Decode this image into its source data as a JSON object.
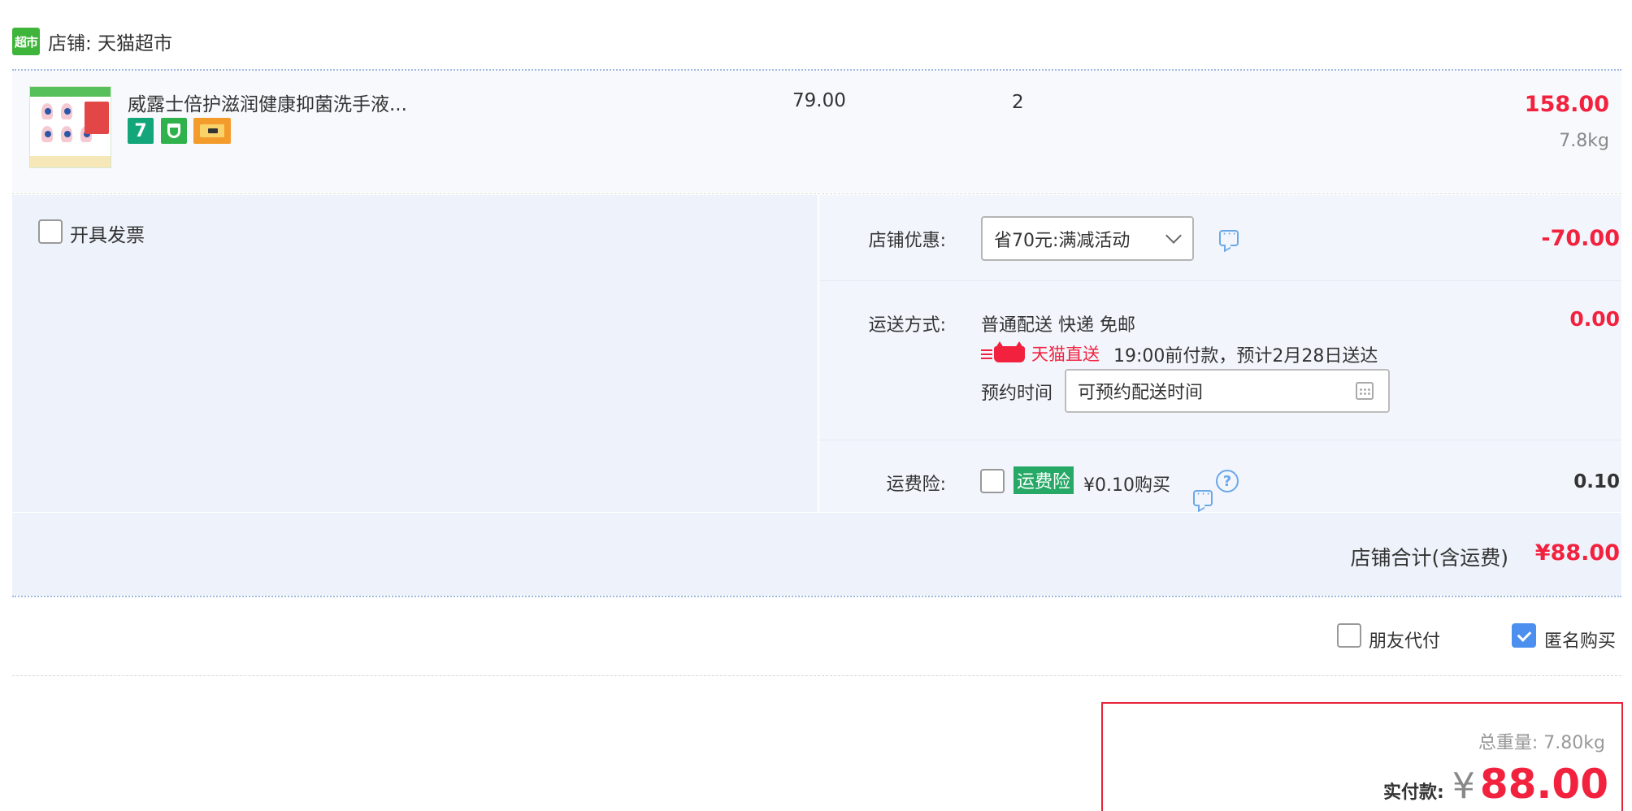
{
  "shop": {
    "logo_text": "超市",
    "label": "店铺: 天猫超市"
  },
  "item": {
    "title": "威露士倍护滋润健康抑菌洗手液...",
    "unit_price": "79.00",
    "quantity": "2",
    "subtotal": "158.00",
    "weight": "7.8kg",
    "tags": [
      "7",
      "shield-icon",
      "card-icon"
    ]
  },
  "invoice": {
    "label": "开具发票",
    "checked": false
  },
  "coupon": {
    "label": "店铺优惠:",
    "selected": "省70元:满减活动",
    "amount": "-70.00"
  },
  "shipping": {
    "label": "运送方式:",
    "method": "普通配送 快递 免邮",
    "direct_label": "天猫直送",
    "eta": "19:00前付款，预计2月28日送达",
    "appoint_label": "预约时间",
    "appoint_placeholder": "可预约配送时间",
    "amount": "0.00"
  },
  "insurance": {
    "label": "运费险:",
    "badge": "运费险",
    "price": "¥0.10购买",
    "help": "?",
    "amount": "0.10"
  },
  "shop_total": {
    "label": "店铺合计(含运费)",
    "amount": "¥88.00"
  },
  "options": {
    "friend_pay": "朋友代付",
    "anonymous": "匿名购买",
    "anonymous_checked": true
  },
  "summary": {
    "total_weight": "总重量: 7.80kg",
    "payable_label": "实付款:",
    "currency": "¥",
    "payable_amount": "88.00"
  },
  "colors": {
    "accent_red": "#f2223f",
    "checkbox_blue": "#4c8fef",
    "insurance_green": "#26a866",
    "panel_bg": "#eef3fb"
  }
}
